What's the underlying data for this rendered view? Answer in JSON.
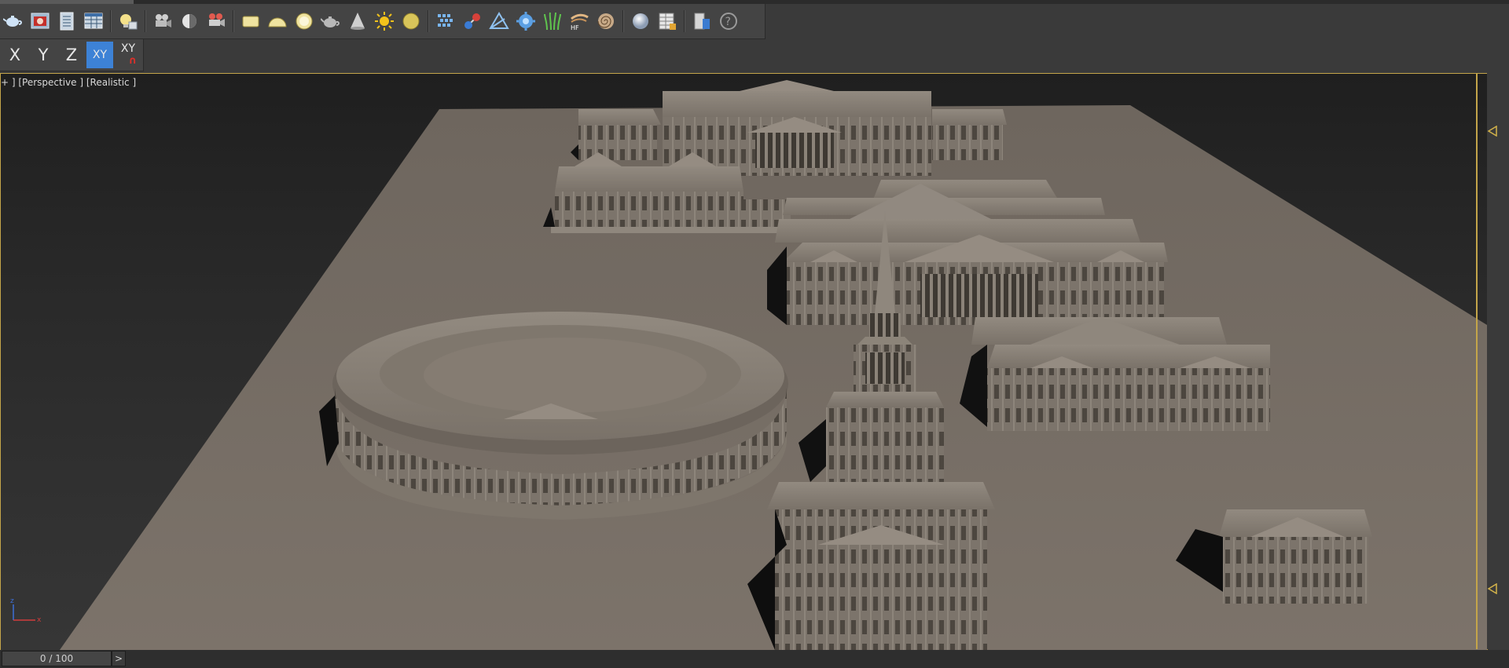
{
  "viewport": {
    "label": "+ ] [Perspective ] [Realistic ]"
  },
  "axis_toolbar": {
    "x": "X",
    "y": "Y",
    "z": "Z",
    "xy": "XY",
    "xy_snap": "XY",
    "active": "XY"
  },
  "time_slider": {
    "frame": "0 / 100",
    "next": ">"
  },
  "colors": {
    "accent_active": "#3d82d6",
    "viewport_border": "#c4a54a",
    "toolbar_bg": "#444444",
    "model_surface": "#7a7169"
  },
  "toolbar_icons": [
    "teapot-render-icon",
    "render-frame-window-icon",
    "render-setup-icon",
    "material-editor-grid-icon",
    "light-lister-icon",
    "camera-icon",
    "photometric-light-icon",
    "camera-rig-icon",
    "plane-icon",
    "hemisphere-icon",
    "sphere-icon",
    "teapot-icon",
    "cone-icon",
    "sun-icon",
    "sphere-yellow-icon",
    "particle-grid-icon",
    "molecule-icon",
    "envelope-icon",
    "gear-particle-icon",
    "grass-icon",
    "hair-fur-icon",
    "spiral-icon",
    "sphere-white-icon",
    "table-icon",
    "object-properties-icon",
    "help-icon"
  ],
  "axis_tripod": {
    "z": "z",
    "x": "x"
  }
}
